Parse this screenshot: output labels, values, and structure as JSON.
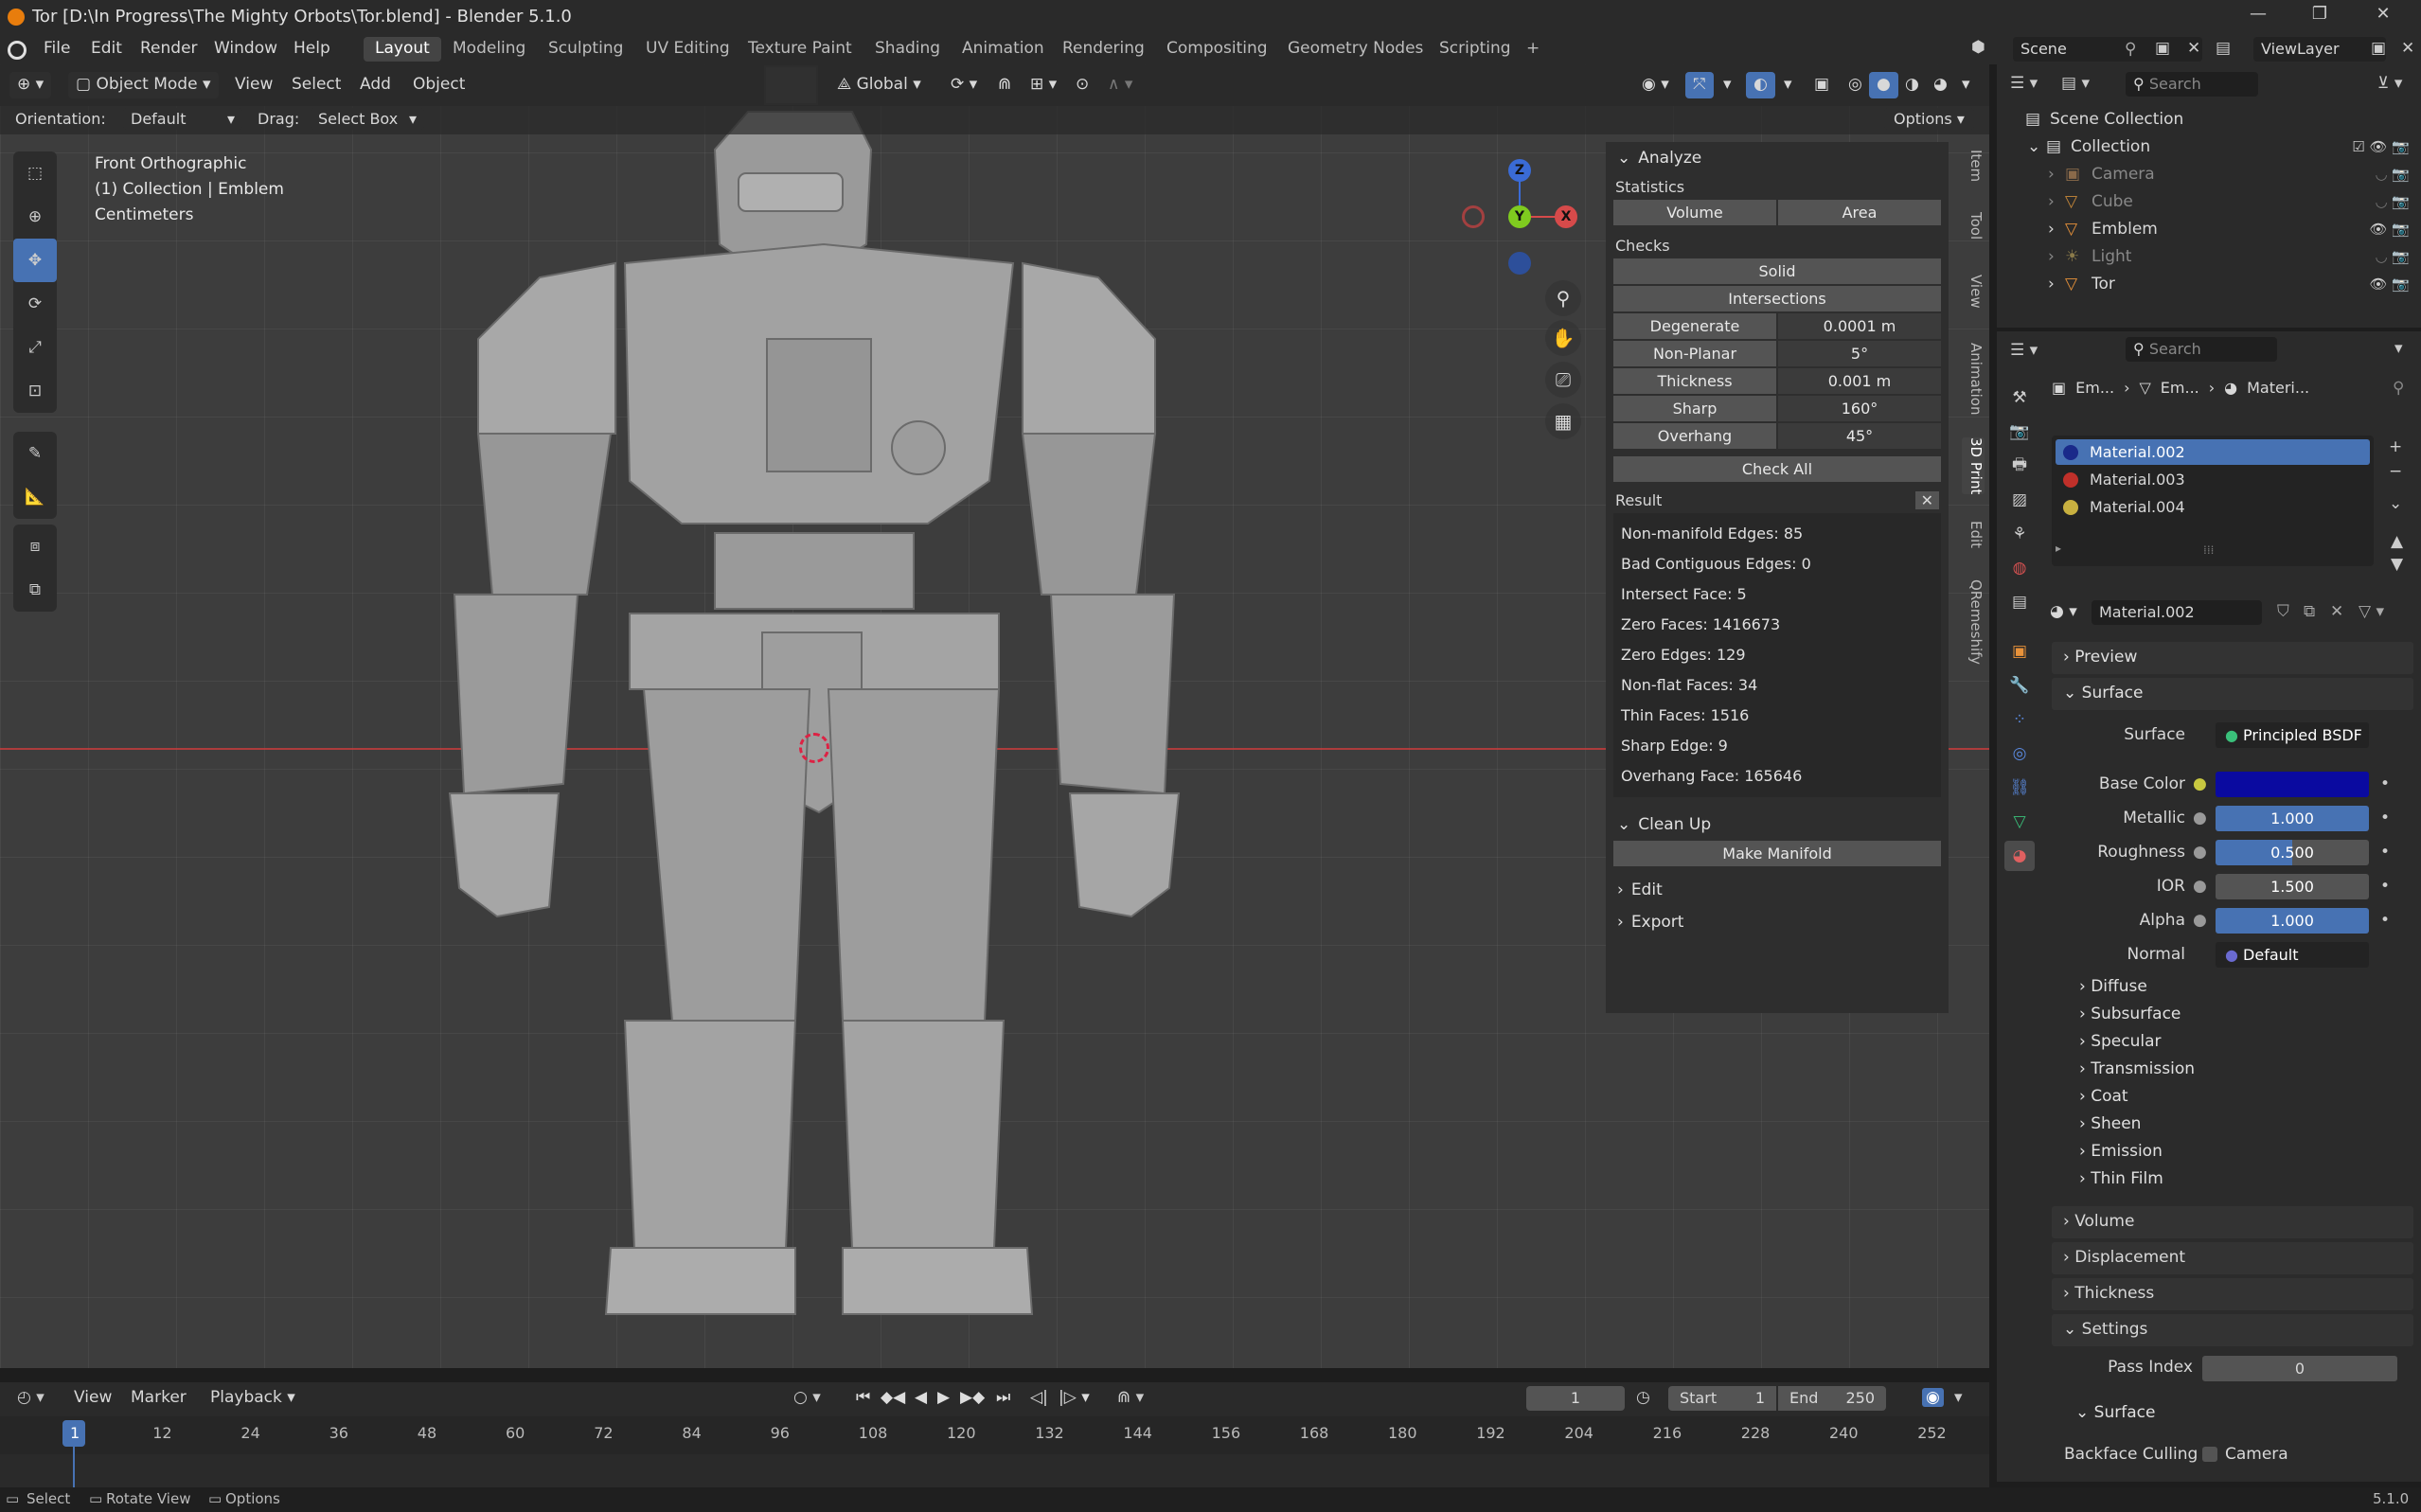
{
  "window": {
    "title": "Tor [D:\\In Progress\\The Mighty Orbots\\Tor.blend] - Blender 5.1.0",
    "minimize": "—",
    "maximize": "❐",
    "close": "✕"
  },
  "menu": {
    "items": [
      "File",
      "Edit",
      "Render",
      "Window",
      "Help"
    ],
    "workspaces": [
      "Layout",
      "Modeling",
      "Sculpting",
      "UV Editing",
      "Texture Paint",
      "Shading",
      "Animation",
      "Rendering",
      "Compositing",
      "Geometry Nodes",
      "Scripting"
    ],
    "active_workspace": "Layout",
    "add_tab": "+",
    "scene": "Scene",
    "view_layer": "ViewLayer"
  },
  "viewport": {
    "mode": "Object Mode",
    "menus": [
      "View",
      "Select",
      "Add",
      "Object"
    ],
    "transform_orientation": "Global",
    "orientation_label": "Orientation:",
    "orientation_value": "Default",
    "drag_label": "Drag:",
    "drag_value": "Select Box",
    "options": "Options",
    "overlay_info": [
      "Front Orthographic",
      "(1) Collection | Emblem",
      "Centimeters"
    ],
    "gizmo": {
      "z": "Z",
      "y": "Y",
      "x": "X"
    }
  },
  "npanel": {
    "tabs": [
      "Item",
      "Tool",
      "View",
      "Animation",
      "3D Print",
      "Edit",
      "QRemeshify"
    ],
    "active_tab": "3D Print",
    "analyze": {
      "title": "Analyze",
      "statistics_label": "Statistics",
      "stat_buttons": [
        "Volume",
        "Area"
      ],
      "checks_label": "Checks",
      "solid": "Solid",
      "intersections": "Intersections",
      "checks": [
        {
          "name": "Degenerate",
          "value": "0.0001 m"
        },
        {
          "name": "Non-Planar",
          "value": "5°"
        },
        {
          "name": "Thickness",
          "value": "0.001 m"
        },
        {
          "name": "Sharp",
          "value": "160°"
        },
        {
          "name": "Overhang",
          "value": "45°"
        }
      ],
      "check_all": "Check All",
      "result_label": "Result",
      "results": [
        "Non-manifold Edges: 85",
        "Bad Contiguous Edges: 0",
        "Intersect Face: 5",
        "Zero Faces: 1416673",
        "Zero Edges: 129",
        "Non-flat Faces: 34",
        "Thin Faces: 1516",
        "Sharp Edge: 9",
        "Overhang Face: 165646"
      ]
    },
    "cleanup": {
      "title": "Clean Up",
      "make_manifold": "Make Manifold"
    },
    "edit": "Edit",
    "export": "Export"
  },
  "outliner": {
    "search_placeholder": "Search",
    "root": "Scene Collection",
    "collection": "Collection",
    "items": [
      {
        "name": "Camera",
        "color": "#8a6a4a",
        "dim": true
      },
      {
        "name": "Cube",
        "color": "#c98a3a",
        "dim": true
      },
      {
        "name": "Emblem",
        "color": "#e8923a",
        "dim": false
      },
      {
        "name": "Light",
        "color": "#8a7a4a",
        "dim": true
      },
      {
        "name": "Tor",
        "color": "#e8923a",
        "dim": false
      }
    ]
  },
  "properties": {
    "search_placeholder": "Search",
    "breadcrumb": [
      "Em...",
      "Em...",
      "Materi..."
    ],
    "materials": [
      {
        "name": "Material.002",
        "color": "#1a2a8a",
        "selected": true
      },
      {
        "name": "Material.003",
        "color": "#c0302a",
        "selected": false
      },
      {
        "name": "Material.004",
        "color": "#c8b040",
        "selected": false
      }
    ],
    "active_material": "Material.002",
    "panels": {
      "preview": "Preview",
      "surface": "Surface",
      "volume": "Volume",
      "displacement": "Displacement",
      "thickness": "Thickness",
      "settings": "Settings",
      "settings_surface": "Surface"
    },
    "surface_fields": [
      {
        "label": "Surface",
        "value": "Principled BSDF"
      },
      {
        "label": "Base Color",
        "value": ""
      },
      {
        "label": "Metallic",
        "value": "1.000"
      },
      {
        "label": "Roughness",
        "value": "0.500"
      },
      {
        "label": "IOR",
        "value": "1.500"
      },
      {
        "label": "Alpha",
        "value": "1.000"
      },
      {
        "label": "Normal",
        "value": "Default"
      }
    ],
    "base_color": "#0a0aa0",
    "subpanels": [
      "Diffuse",
      "Subsurface",
      "Specular",
      "Transmission",
      "Coat",
      "Sheen",
      "Emission",
      "Thin Film"
    ],
    "pass_index_label": "Pass Index",
    "pass_index": "0",
    "backface_culling_label": "Backface Culling",
    "backface_option": "Camera"
  },
  "timeline": {
    "menus": [
      "View",
      "Marker",
      "Playback"
    ],
    "current_frame": "1",
    "start_label": "Start",
    "start": "1",
    "end_label": "End",
    "end": "250",
    "ticks": [
      "1",
      "12",
      "24",
      "36",
      "48",
      "60",
      "72",
      "84",
      "96",
      "108",
      "120",
      "132",
      "144",
      "156",
      "168",
      "180",
      "192",
      "204",
      "216",
      "228",
      "240",
      "252"
    ]
  },
  "status": {
    "select": "Select",
    "rotate": "Rotate View",
    "options": "Options",
    "version": "5.1.0"
  }
}
